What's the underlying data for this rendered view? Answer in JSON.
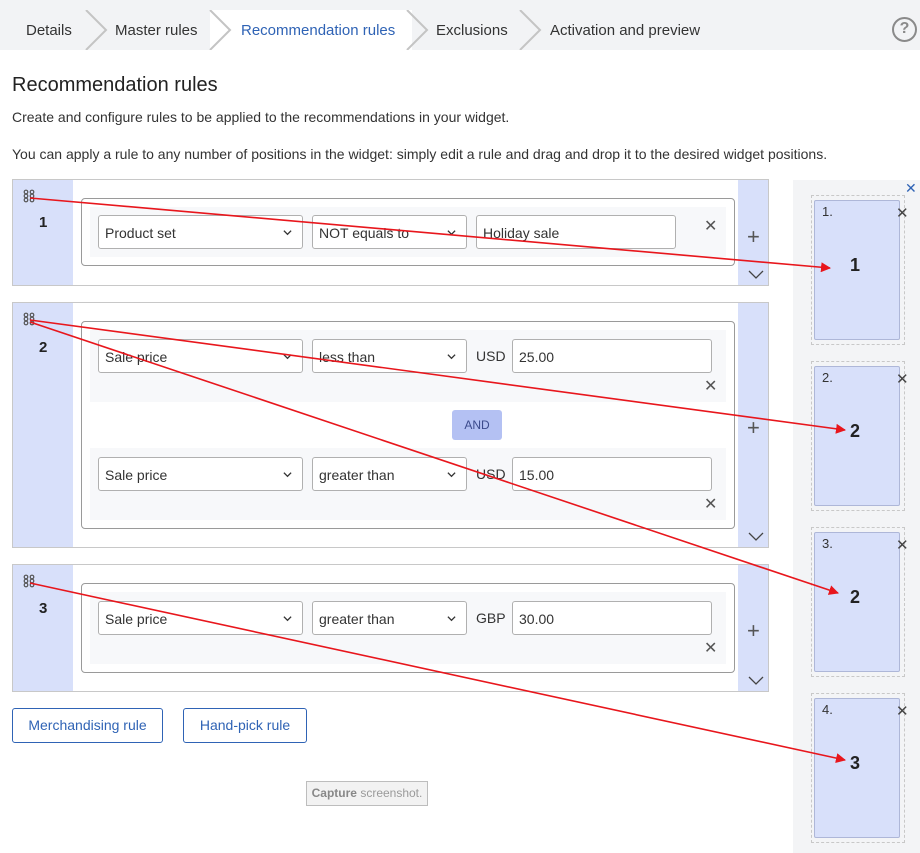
{
  "breadcrumb": {
    "steps": [
      "Details",
      "Master rules",
      "Recommendation rules",
      "Exclusions",
      "Activation and preview"
    ],
    "help": "?"
  },
  "page": {
    "title": "Recommendation rules",
    "desc1": "Create and configure rules to be applied to the recommendations in your widget.",
    "desc2": "You can apply a rule to any number of positions in the widget: simply edit a rule and drag and drop it to the desired widget positions."
  },
  "rules": [
    {
      "number": "1",
      "c1": {
        "field": "Product set",
        "operator": "NOT equals to",
        "value": "Holiday sale"
      }
    },
    {
      "number": "2",
      "c1": {
        "field": "Sale price",
        "operator": "less than",
        "currency": "USD",
        "value": "25.00"
      },
      "joiner": "AND",
      "c2": {
        "field": "Sale price",
        "operator": "greater than",
        "currency": "USD",
        "value": "15.00"
      }
    },
    {
      "number": "3",
      "c1": {
        "field": "Sale price",
        "operator": "greater than",
        "currency": "GBP",
        "value": "30.00"
      }
    }
  ],
  "buttons": {
    "merchandising": "Merchandising rule",
    "handpick": "Hand-pick rule"
  },
  "capture": {
    "bold": "Capture",
    "rest": " screenshot."
  },
  "positions": [
    {
      "index": "1.",
      "rule": "1"
    },
    {
      "index": "2.",
      "rule": "2"
    },
    {
      "index": "3.",
      "rule": "2"
    },
    {
      "index": "4.",
      "rule": "3"
    }
  ],
  "colors": {
    "accent": "#2f63b5",
    "annotation": "#e8161c",
    "handle": "#d8e0fa"
  }
}
